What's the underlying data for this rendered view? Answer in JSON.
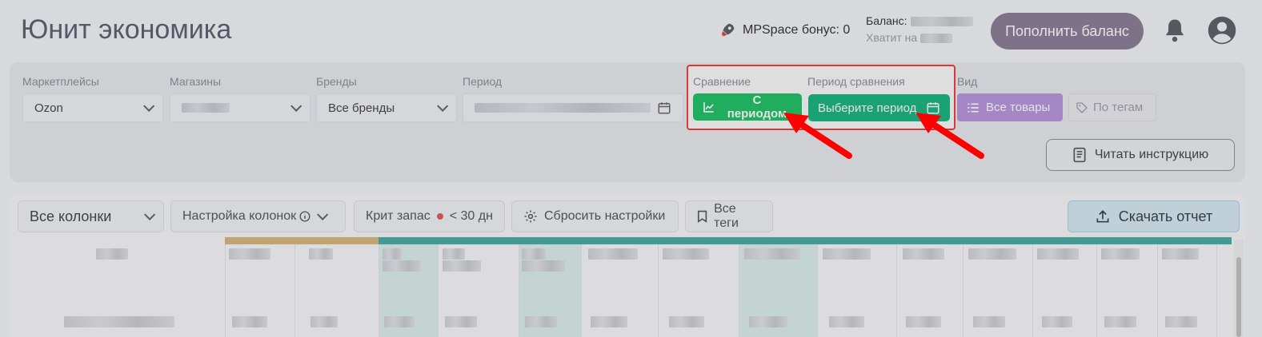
{
  "header": {
    "title": "Юнит экономика",
    "bonus_label": "MPSpace бонус: 0",
    "balance_label": "Баланс:",
    "enough_label": "Хватит на",
    "topup_label": "Пополнить баланс"
  },
  "filters": {
    "marketplaces": {
      "label": "Маркетплейсы",
      "value": "Ozon"
    },
    "shops": {
      "label": "Магазины",
      "value": ""
    },
    "brands": {
      "label": "Бренды",
      "value": "Все бренды"
    },
    "period": {
      "label": "Период",
      "value": ""
    },
    "comparison": {
      "label": "Сравнение",
      "button": "С периодом"
    },
    "comparison_period": {
      "label": "Период сравнения",
      "button": "Выберите период"
    },
    "view": {
      "label": "Вид",
      "all_products": "Все товары",
      "by_tags": "По тегам"
    },
    "instruction_button": "Читать инструкцию"
  },
  "toolbar": {
    "all_columns": "Все колонки",
    "column_settings": "Настройка колонок",
    "crit_stock": "Крит запас",
    "crit_stock_value": "< 30 дн",
    "reset_settings": "Сбросить настройки",
    "all_tags": "Все теги",
    "download": "Скачать отчет"
  },
  "colors": {
    "green_primary": "#1fc266",
    "green_secondary": "#19b47f",
    "violet": "#b896dd",
    "topup": "#8a7e95",
    "highlight": "#f23b3b"
  }
}
